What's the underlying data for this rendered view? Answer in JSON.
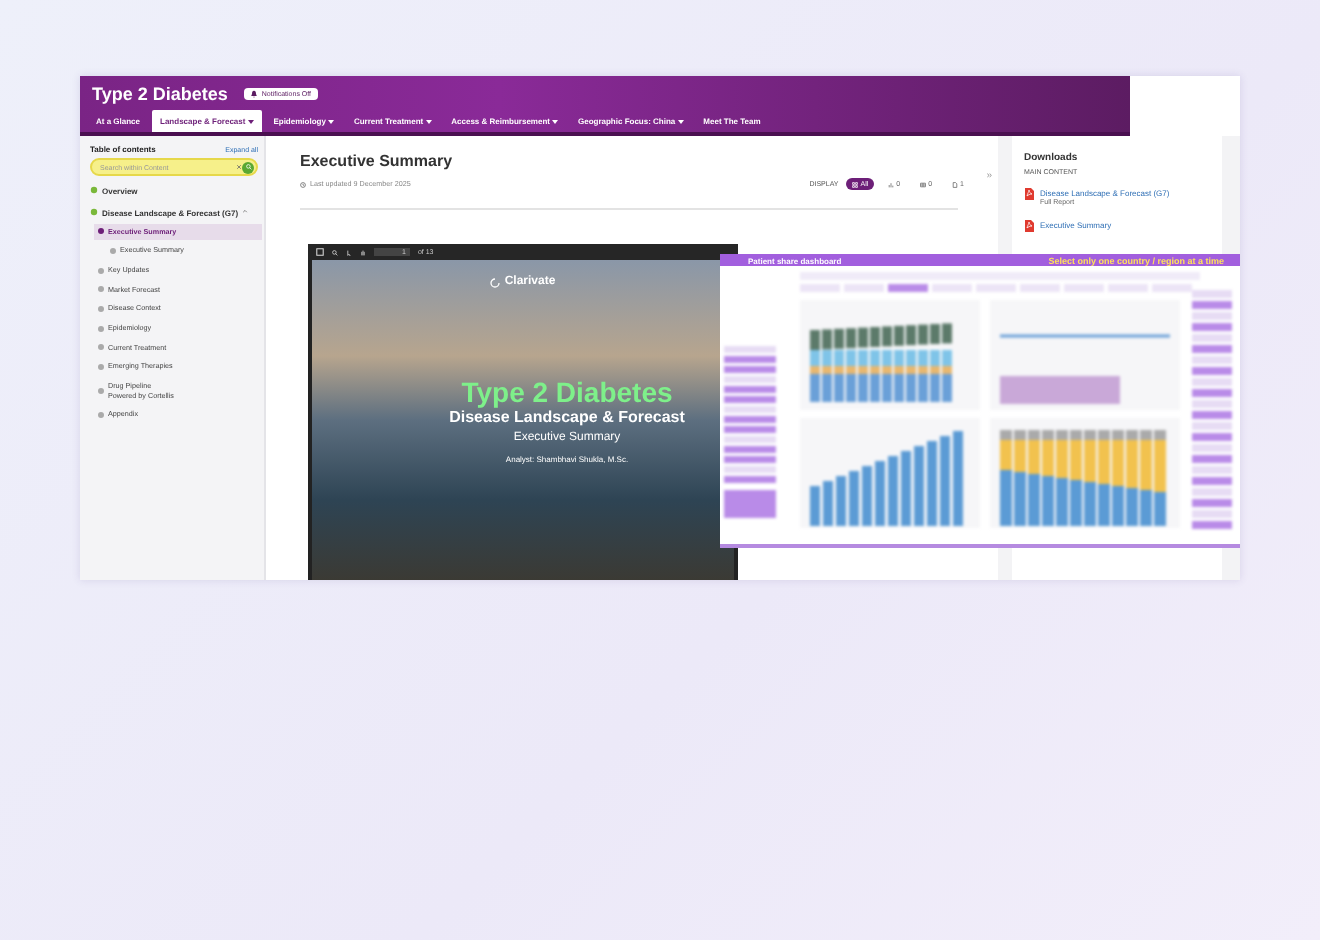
{
  "header": {
    "title": "Type 2 Diabetes",
    "notifications": "Notifications Off"
  },
  "nav": [
    {
      "label": "At a Glance",
      "selected": false,
      "caret": false
    },
    {
      "label": "Landscape & Forecast",
      "selected": true,
      "caret": true
    },
    {
      "label": "Epidemiology",
      "selected": false,
      "caret": true
    },
    {
      "label": "Current Treatment",
      "selected": false,
      "caret": true
    },
    {
      "label": "Access & Reimbursement",
      "selected": false,
      "caret": true
    },
    {
      "label": "Geographic Focus: China",
      "selected": false,
      "caret": true
    },
    {
      "label": "Meet The Team",
      "selected": false,
      "caret": false
    }
  ],
  "sidebar": {
    "title": "Table of contents",
    "expand": "Expand all",
    "search": {
      "placeholder": "Search within Content"
    },
    "items": [
      {
        "label": "Overview",
        "expanded": false
      },
      {
        "label": "Disease Landscape & Forecast (G7)",
        "expanded": true,
        "children": [
          {
            "label": "Executive Summary",
            "selected": true,
            "children": [
              {
                "label": "Executive Summary",
                "selected": false
              }
            ]
          },
          {
            "label": "Key Updates",
            "selected": false
          },
          {
            "label": "Market Forecast",
            "selected": false
          },
          {
            "label": "Disease Context",
            "selected": false
          },
          {
            "label": "Epidemiology",
            "selected": false
          },
          {
            "label": "Current Treatment",
            "selected": false
          },
          {
            "label": "Emerging Therapies",
            "selected": false
          },
          {
            "label": "Drug Pipeline\nPowered by Cortellis",
            "selected": false
          },
          {
            "label": "Appendix",
            "selected": false
          }
        ]
      }
    ]
  },
  "main": {
    "title": "Executive Summary",
    "collapse": "»",
    "updated": "Last updated 9 December 2025",
    "display_label": "DISPLAY",
    "display": [
      {
        "kind": "all",
        "label": "All",
        "selected": true
      },
      {
        "kind": "chart",
        "label": "0",
        "selected": false
      },
      {
        "kind": "table",
        "label": "0",
        "selected": false
      },
      {
        "kind": "doc",
        "label": "1",
        "selected": false
      }
    ],
    "viewer": {
      "page": "1",
      "of": "of 13",
      "logo": "Clarivate",
      "title": "Type 2 Diabetes",
      "subtitle": "Disease Landscape & Forecast",
      "section": "Executive Summary",
      "analyst": "Analyst: Shambhavi Shukla, M.Sc."
    }
  },
  "downloads": {
    "title": "Downloads",
    "section": "MAIN CONTENT",
    "files": [
      {
        "name": "Disease Landscape & Forecast (G7)",
        "note": "Full Report"
      },
      {
        "name": "Executive Summary"
      }
    ]
  },
  "dashboard": {
    "title": "Patient share dashboard",
    "hint": "Select only one country / region at a time"
  }
}
